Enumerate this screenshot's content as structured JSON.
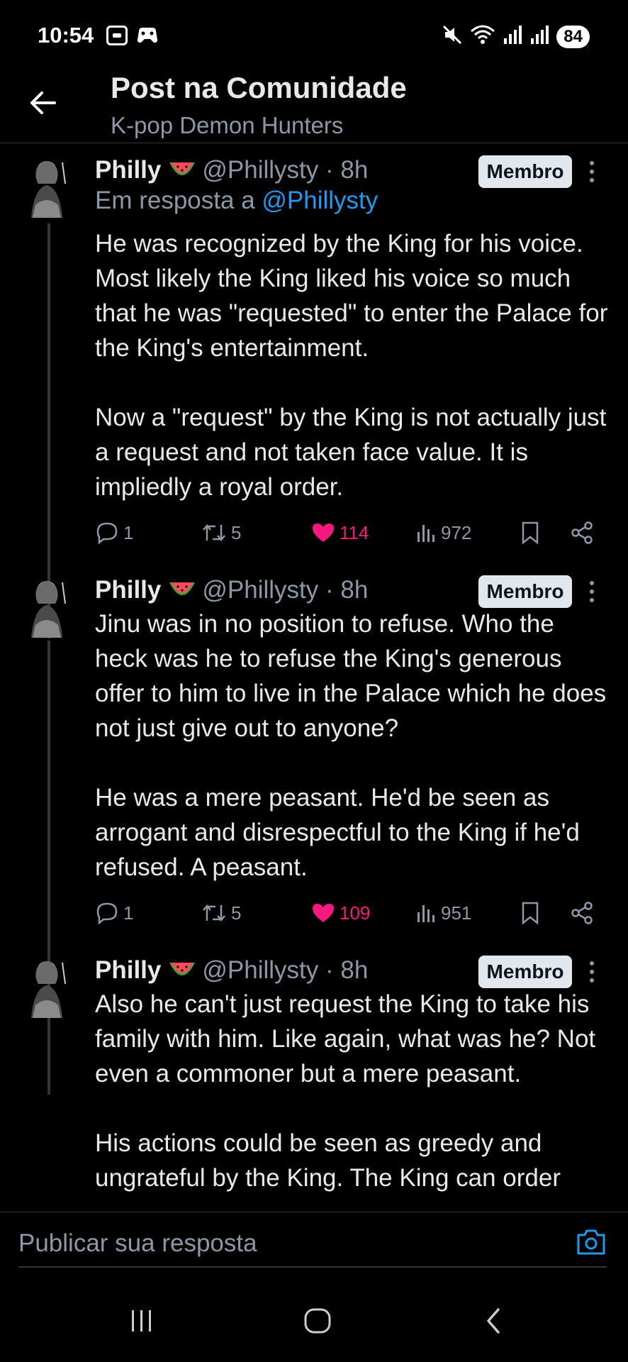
{
  "status_bar": {
    "time": "10:54",
    "battery": "84"
  },
  "header": {
    "title": "Post na Comunidade",
    "subtitle": "K-pop Demon Hunters"
  },
  "posts": [
    {
      "name": "Philly",
      "handle": "@Phillysty · 8h",
      "badge": "Membro",
      "reply_prefix": "Em resposta a ",
      "reply_handle": "@Phillysty",
      "paragraphs": [
        "He was recognized by the King for his voice. Most likely the King liked his voice so much that he was \"requested\" to enter the Palace for the King's entertainment.",
        "Now a \"request\" by the King is not actually just a request and not taken face value. It is impliedly a royal order."
      ],
      "replies": "1",
      "reposts": "5",
      "likes": "114",
      "views": "972"
    },
    {
      "name": "Philly",
      "handle": "@Phillysty · 8h",
      "badge": "Membro",
      "paragraphs": [
        "Jinu was in no position to refuse. Who the heck was he to refuse the King's generous offer to him to live in the Palace which he does not just give out to anyone?",
        "He was a mere peasant. He'd be seen as arrogant and disrespectful to the King if he'd refused. A peasant."
      ],
      "replies": "1",
      "reposts": "5",
      "likes": "109",
      "views": "951"
    },
    {
      "name": "Philly",
      "handle": "@Phillysty · 8h",
      "badge": "Membro",
      "paragraphs": [
        "Also he can't just request the King to take his family with him. Like again, what was he? Not even a commoner but a mere peasant.",
        "His actions could be seen as greedy and ungrateful by the King. The King can order"
      ]
    }
  ],
  "reply_bar": {
    "placeholder": "Publicar sua resposta"
  },
  "colors": {
    "background": "#000000",
    "text": "#e7e9ea",
    "secondary": "#8b98a5",
    "link": "#1d9bf0",
    "like": "#f91880"
  }
}
